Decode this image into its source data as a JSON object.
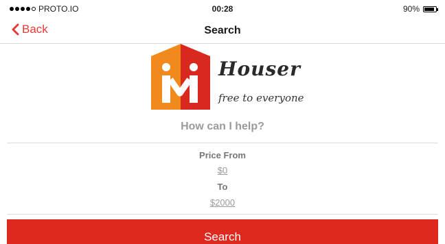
{
  "status_bar": {
    "carrier": "PROTO.IO",
    "time": "00:28",
    "battery": "90%",
    "battery_level": 0.9
  },
  "nav": {
    "back_label": "Back",
    "title": "Search"
  },
  "logo": {
    "name": "Houser",
    "tagline": "free to everyone",
    "colors": {
      "orange": "#f08a1c",
      "red": "#d9281e"
    }
  },
  "prompt": "How can I help?",
  "filters": {
    "price_from_label": "Price From",
    "price_from_value": "$0",
    "to_label": "To",
    "to_value": "$2000"
  },
  "search_button": {
    "label": "Search",
    "color": "#de2a1e"
  },
  "accent_color": "#e53935"
}
